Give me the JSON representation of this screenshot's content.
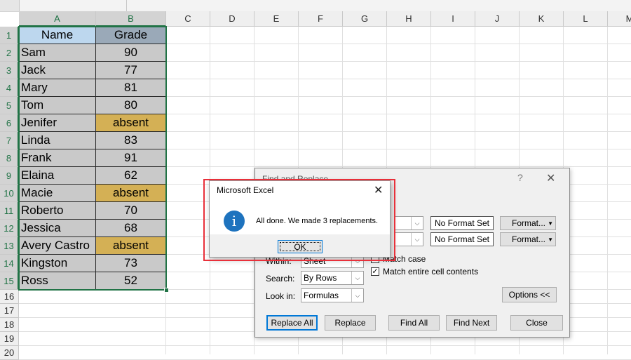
{
  "sheet": {
    "columns": [
      "A",
      "B",
      "C",
      "D",
      "E",
      "F",
      "G",
      "H",
      "I",
      "J",
      "K",
      "L",
      "M"
    ],
    "row_numbers": [
      "1",
      "2",
      "3",
      "4",
      "5",
      "6",
      "7",
      "8",
      "9",
      "10",
      "11",
      "12",
      "13",
      "14",
      "15",
      "16",
      "17",
      "18",
      "19",
      "20"
    ],
    "header": {
      "name": "Name",
      "grade": "Grade"
    },
    "rows": [
      {
        "name": "Sam",
        "grade": "90",
        "absent": false
      },
      {
        "name": "Jack",
        "grade": "77",
        "absent": false
      },
      {
        "name": "Mary",
        "grade": "81",
        "absent": false
      },
      {
        "name": "Tom",
        "grade": "80",
        "absent": false
      },
      {
        "name": "Jenifer",
        "grade": "absent",
        "absent": true
      },
      {
        "name": "Linda",
        "grade": "83",
        "absent": false
      },
      {
        "name": "Frank",
        "grade": "91",
        "absent": false
      },
      {
        "name": "Elaina",
        "grade": "62",
        "absent": false
      },
      {
        "name": "Macie",
        "grade": "absent",
        "absent": true
      },
      {
        "name": "Roberto",
        "grade": "70",
        "absent": false
      },
      {
        "name": "Jessica",
        "grade": "68",
        "absent": false
      },
      {
        "name": "Avery Castro",
        "grade": "absent",
        "absent": true
      },
      {
        "name": "Kingston",
        "grade": "73",
        "absent": false
      },
      {
        "name": "Ross",
        "grade": "52",
        "absent": false
      }
    ]
  },
  "find_replace": {
    "title": "Find and Replace",
    "help": "?",
    "close": "✕",
    "no_format_1": "No Format Set",
    "no_format_2": "No Format Set",
    "format_1": "Format...",
    "format_2": "Format...",
    "within_label": "Within:",
    "within_value": "Sheet",
    "search_label": "Search:",
    "search_value": "By Rows",
    "lookin_label": "Look in:",
    "lookin_value": "Formulas",
    "match_case": "Match case",
    "match_entire": "Match entire cell contents",
    "match_entire_checked": true,
    "options": "Options <<",
    "replace_all": "Replace All",
    "replace": "Replace",
    "find_all": "Find All",
    "find_next": "Find Next",
    "close_btn": "Close"
  },
  "message_box": {
    "title": "Microsoft Excel",
    "close": "✕",
    "icon": "info-icon",
    "icon_glyph": "i",
    "message": "All done. We made 3 replacements.",
    "ok": "OK"
  },
  "colors": {
    "selection": "#217346",
    "absent_fill": "#d4b055",
    "highlight": "#e8303a"
  }
}
